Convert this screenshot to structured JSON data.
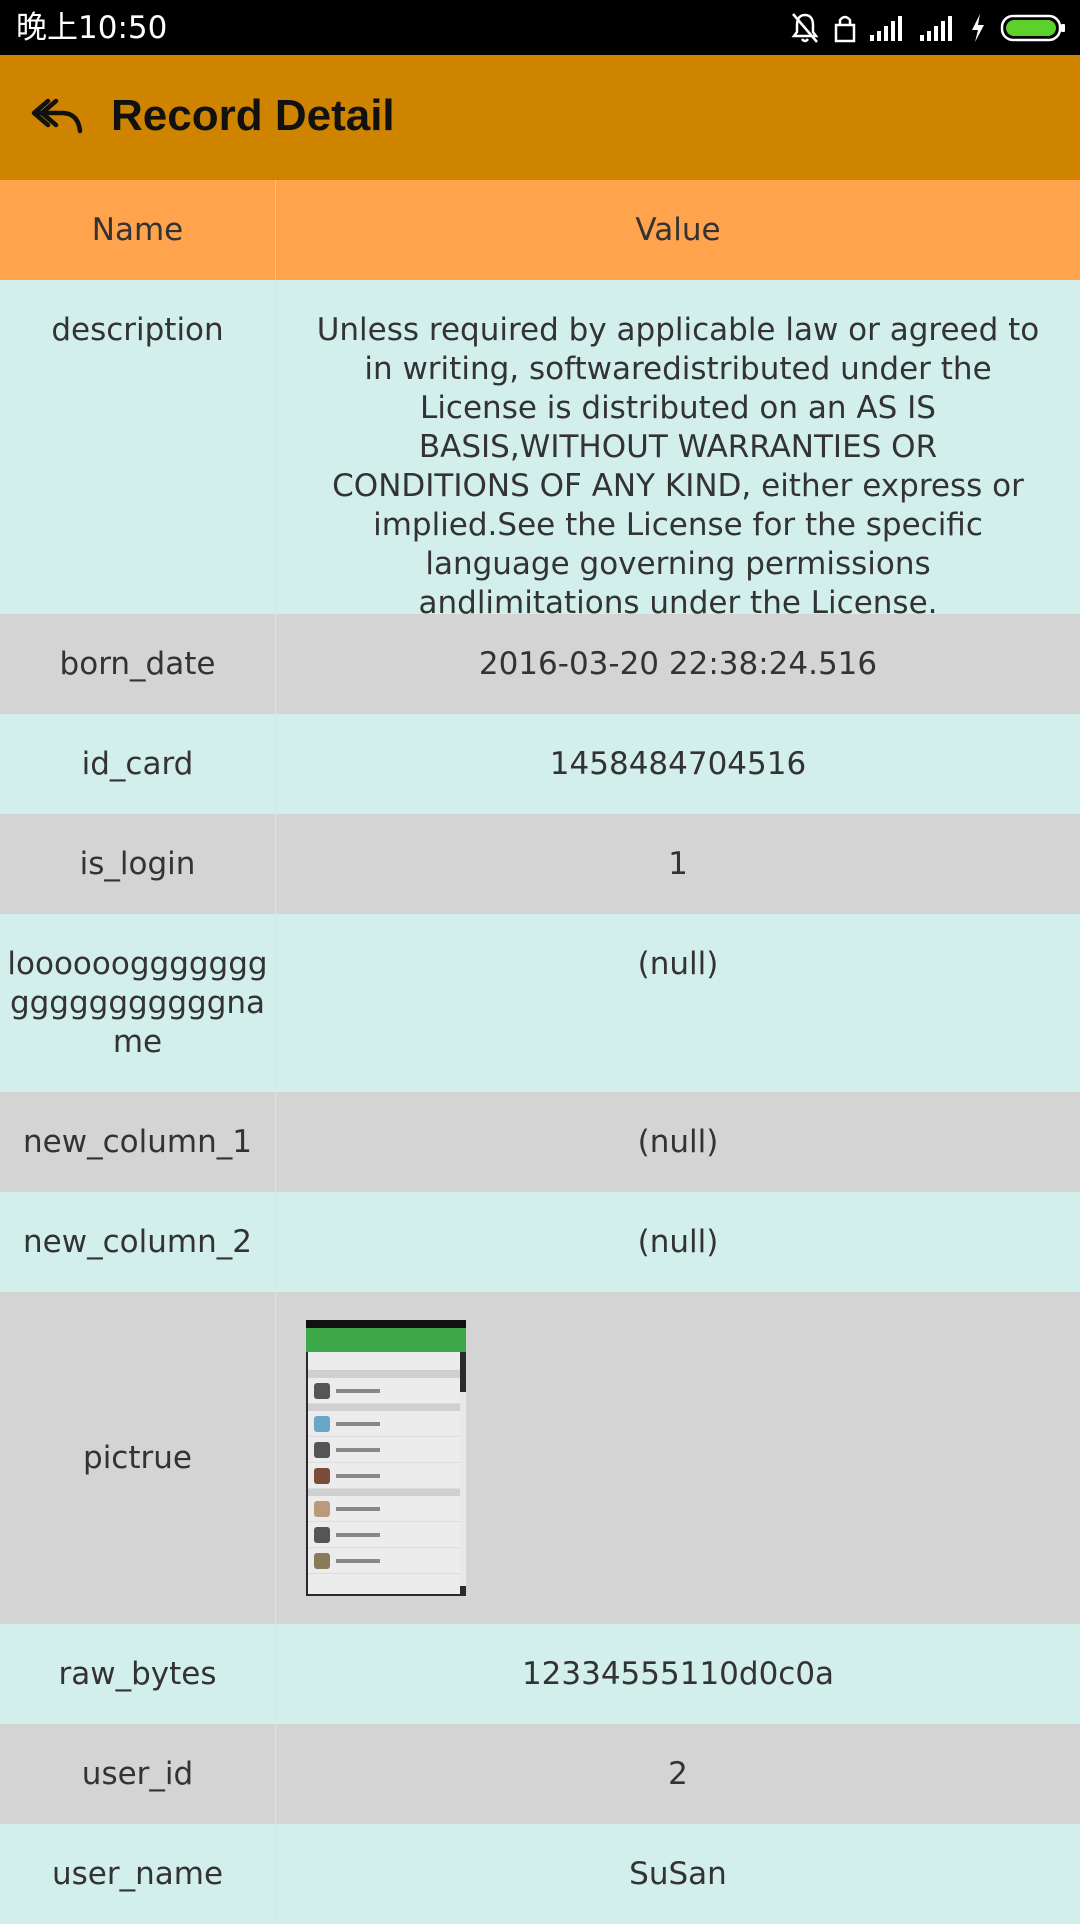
{
  "status_bar": {
    "time": "晚上10:50"
  },
  "app_bar": {
    "title": "Record Detail"
  },
  "table": {
    "headers": {
      "name": "Name",
      "value": "Value"
    },
    "rows": [
      {
        "name": "description",
        "value": "Unless required by applicable law or agreed to in writing, softwaredistributed under the License is distributed on an AS IS BASIS,WITHOUT WARRANTIES OR CONDITIONS OF ANY KIND, either express or implied.See the License for the specific language governing permissions andlimitations under the License."
      },
      {
        "name": "born_date",
        "value": "2016-03-20 22:38:24.516"
      },
      {
        "name": "id_card",
        "value": "1458484704516"
      },
      {
        "name": "is_login",
        "value": "1"
      },
      {
        "name": "looooooggggggggggggggggggname",
        "value": "(null)"
      },
      {
        "name": "new_column_1",
        "value": "(null)"
      },
      {
        "name": "new_column_2",
        "value": "(null)"
      },
      {
        "name": "pictrue",
        "value": ""
      },
      {
        "name": "raw_bytes",
        "value": "12334555110d0c0a"
      },
      {
        "name": "user_id",
        "value": "2"
      },
      {
        "name": "user_name",
        "value": "SuSan"
      }
    ]
  }
}
